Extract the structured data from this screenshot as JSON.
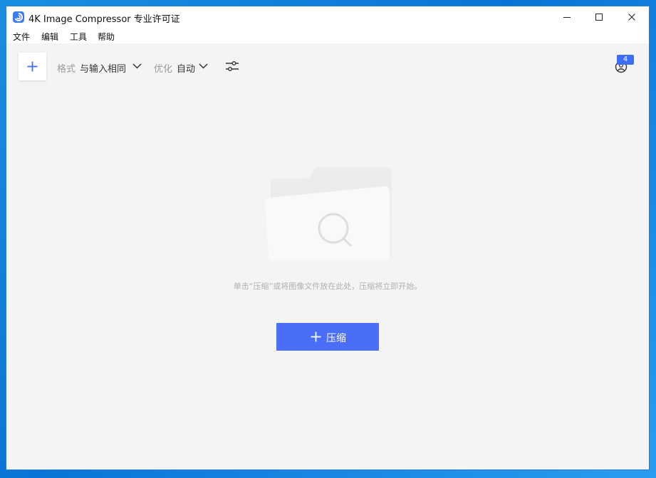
{
  "window": {
    "title": "4K Image Compressor 专业许可证",
    "app_icon": "app-logo-icon",
    "controls": [
      "minimize-icon",
      "maximize-icon",
      "close-icon"
    ]
  },
  "menu": {
    "file": "文件",
    "edit": "编辑",
    "tools": "工具",
    "help": "帮助"
  },
  "toolbar": {
    "format_label": "格式",
    "format_value": "与输入相同",
    "optimize_label": "优化",
    "optimize_value": "自动",
    "badge_count": "4"
  },
  "main": {
    "hint": "单击“压缩”或将图像文件放在此处，压缩将立即开始。",
    "compress_label": "压缩"
  },
  "colors": {
    "accent": "#4a6ef7",
    "background": "#f4f4f4",
    "desktop": "#0a74d6"
  }
}
